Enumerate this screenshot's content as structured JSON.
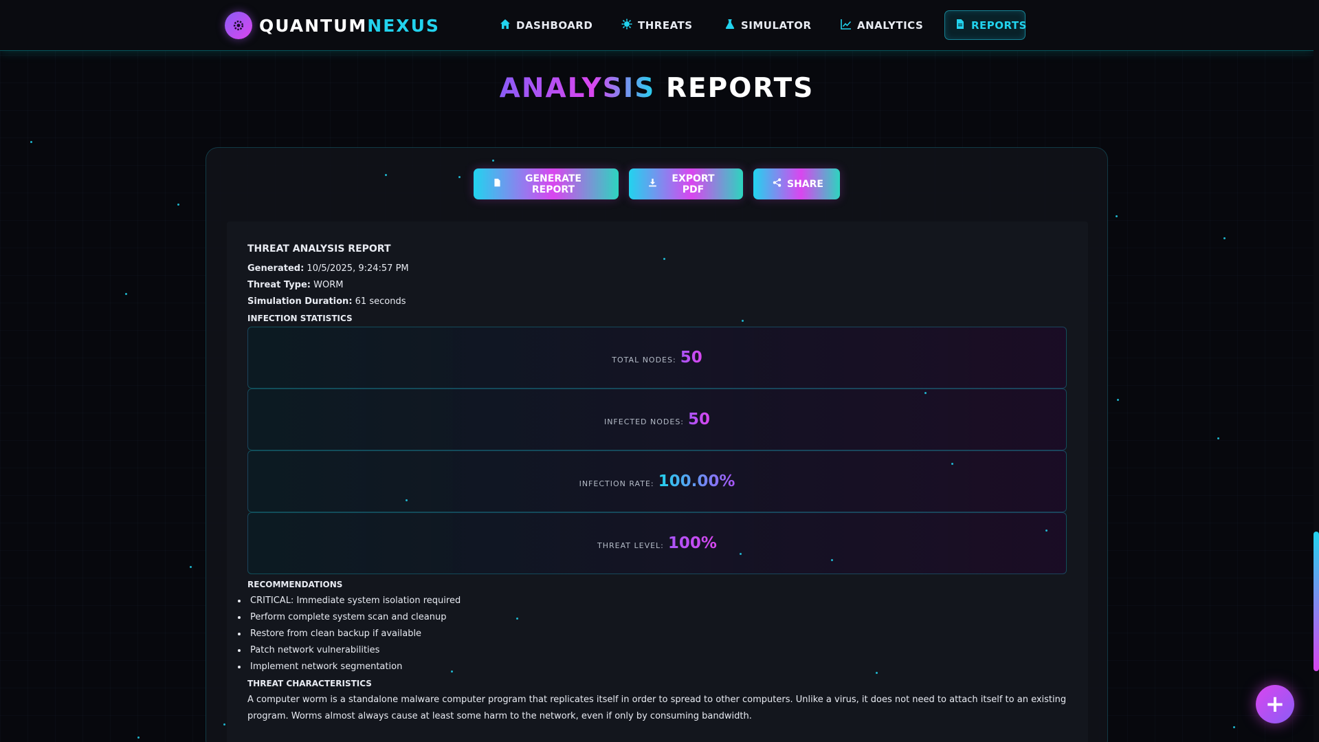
{
  "app": {
    "logo_part1": "QUANTUM",
    "logo_part2": "NEXUS"
  },
  "nav": {
    "items": [
      {
        "label": "DASHBOARD",
        "icon": "home-icon"
      },
      {
        "label": "THREATS",
        "icon": "virus-icon"
      },
      {
        "label": "SIMULATOR",
        "icon": "flask-icon"
      },
      {
        "label": "ANALYTICS",
        "icon": "line-chart-icon"
      },
      {
        "label": "REPORTS",
        "icon": "file-icon",
        "active": true
      }
    ]
  },
  "page": {
    "title_part1": "ANALYSIS",
    "title_part2": "REPORTS"
  },
  "actions": {
    "generate": "GENERATE REPORT",
    "export": "EXPORT PDF",
    "share": "SHARE"
  },
  "report": {
    "title": "THREAT ANALYSIS REPORT",
    "generated_label": "Generated:",
    "generated_value": "10/5/2025, 9:24:57 PM",
    "threat_type_label": "Threat Type:",
    "threat_type_value": "WORM",
    "duration_label": "Simulation Duration:",
    "duration_value": "61 seconds",
    "stats_heading": "INFECTION STATISTICS",
    "stats": [
      {
        "label": "TOTAL NODES:",
        "value": "50"
      },
      {
        "label": "INFECTED NODES:",
        "value": "50"
      },
      {
        "label": "INFECTION RATE:",
        "value": "100.00%"
      },
      {
        "label": "THREAT LEVEL:",
        "value": "100%"
      }
    ],
    "recommendations_heading": "RECOMMENDATIONS",
    "recommendations": [
      "CRITICAL: Immediate system isolation required",
      "Perform complete system scan and cleanup",
      "Restore from clean backup if available",
      "Patch network vulnerabilities",
      "Implement network segmentation"
    ],
    "characteristics_heading": "THREAT CHARACTERISTICS",
    "characteristics_text": "A computer worm is a standalone malware computer program that replicates itself in order to spread to other computers. Unlike a virus, it does not need to attach itself to an existing program. Worms almost always cause at least some harm to the network, even if only by consuming bandwidth."
  },
  "fab": {
    "label": "+"
  },
  "colors": {
    "accent_cyan": "#22d3ee",
    "accent_magenta": "#d946ef",
    "accent_purple": "#8b5cf6",
    "background": "#07080d"
  }
}
